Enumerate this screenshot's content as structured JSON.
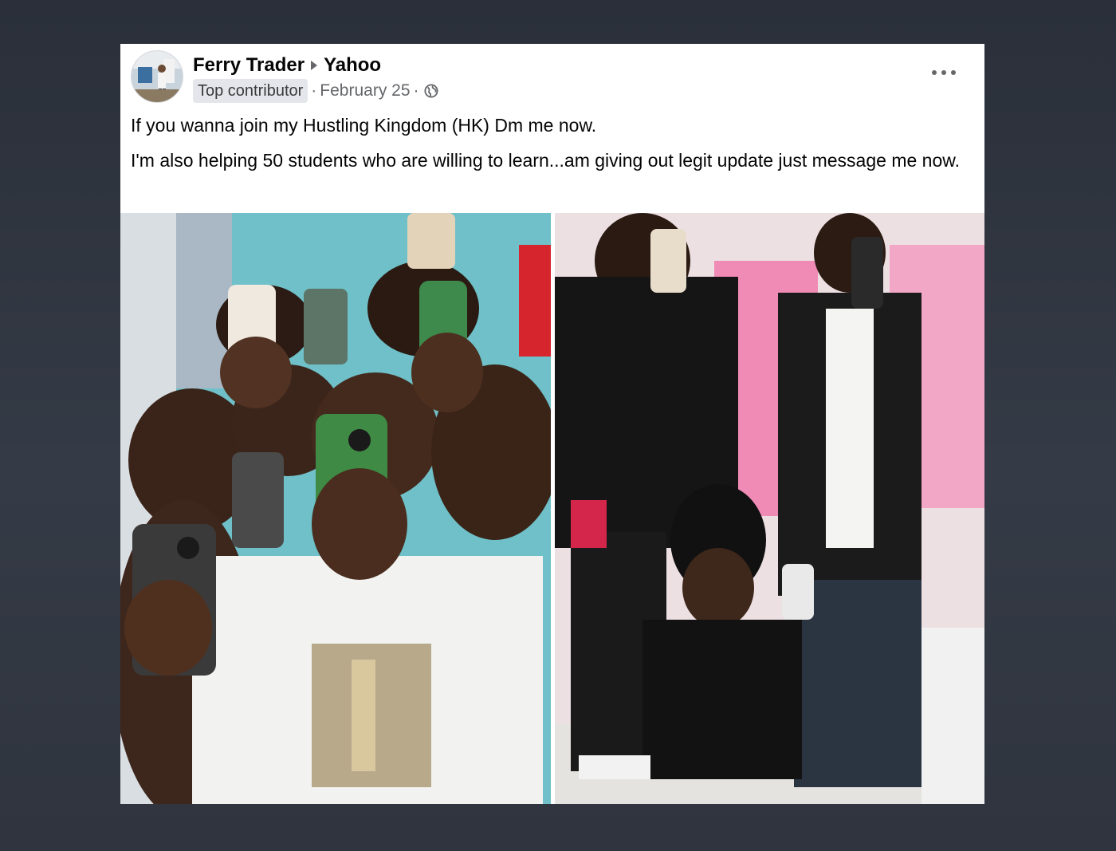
{
  "post": {
    "author": "Ferry Trader",
    "group": "Yahoo",
    "badge": "Top contributor",
    "separator": "·",
    "date": "February 25",
    "privacy_icon": "globe-icon",
    "more_icon": "more-options-icon",
    "text_lines": [
      "If you wanna join my Hustling Kingdom (HK) Dm me now.",
      "I'm also helping 50 students who are willing to learn...am giving out legit update just message me now."
    ],
    "photos": [
      {
        "description_name": "group-phone-selfie-photo-left"
      },
      {
        "description_name": "group-phone-selfie-photo-right"
      }
    ]
  },
  "colors": {
    "background": "#2f343e",
    "card": "#ffffff",
    "primary_text": "#050505",
    "secondary_text": "#65676b",
    "badge_bg": "#e4e6eb"
  }
}
